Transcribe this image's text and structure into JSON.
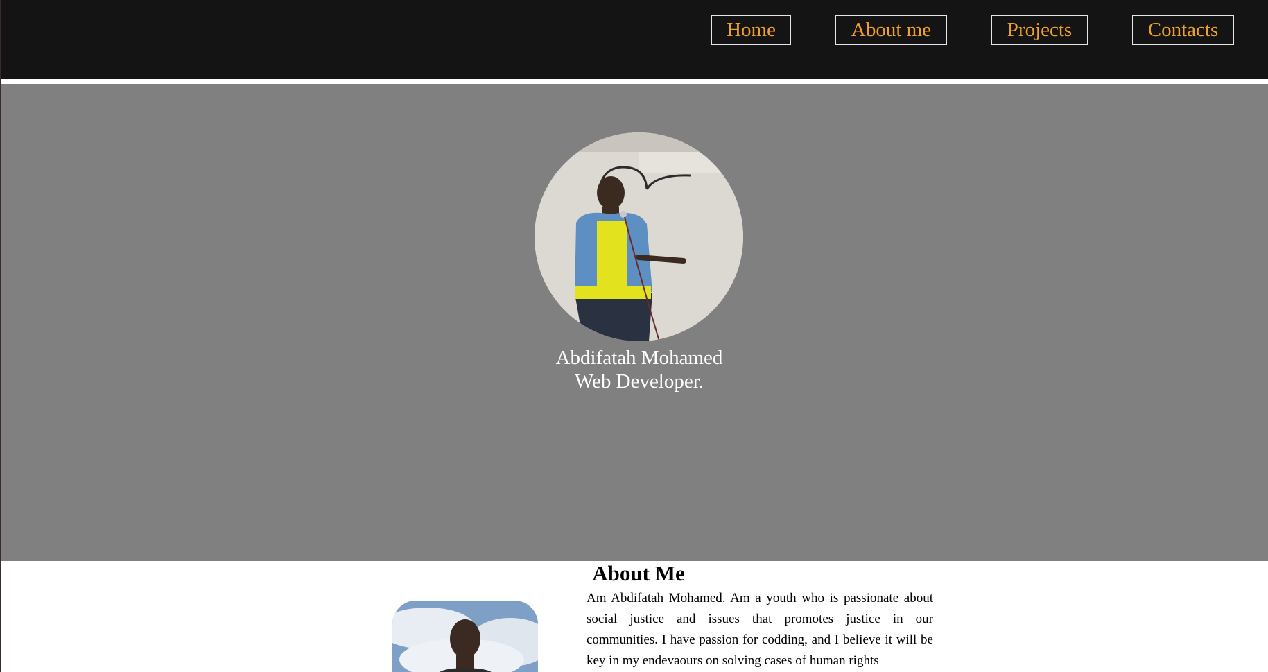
{
  "nav": {
    "home_label": "Home",
    "about_label": "About me",
    "projects_label": "Projects",
    "contacts_label": "Contacts",
    "accent_color": "#f0a028",
    "background_color": "#141414"
  },
  "hero": {
    "name": "Abdifatah Mohamed",
    "role": "Web Developer.",
    "background_color": "#808080"
  },
  "about": {
    "title": "About Me",
    "text": "Am Abdifatah Mohamed. Am a youth who is passionate about social justice and issues that promotes justice in our communities. I have passion for codding, and I believe it will be key in my endevaours on solving cases of human rights"
  }
}
